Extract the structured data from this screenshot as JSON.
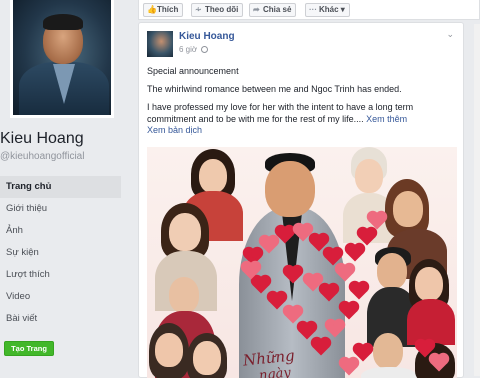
{
  "sidebar": {
    "page_name": "Kieu Hoang",
    "handle": "@kieuhoangofficial",
    "items": [
      {
        "label": "Trang chủ"
      },
      {
        "label": "Giới thiệu"
      },
      {
        "label": "Ảnh"
      },
      {
        "label": "Sự kiện"
      },
      {
        "label": "Lượt thích"
      },
      {
        "label": "Video"
      },
      {
        "label": "Bài viết"
      }
    ],
    "create_page_label": "Tạo Trang"
  },
  "actionbar": {
    "like": "Thích",
    "follow": "Theo dõi",
    "share": "Chia sẻ",
    "more": "Khác"
  },
  "post": {
    "author": "Kieu Hoang",
    "time": "6 giờ",
    "line1": "Special announcement",
    "line2": "The whirlwind romance between me and Ngoc Trinh has ended.",
    "line3": "I have professed my love for her with the intent to have a long term commitment and to be with me for the rest of my life....",
    "see_more": "Xem thêm",
    "translate": "Xem bản dịch",
    "image_text_1": "Những",
    "image_text_2": "ngày"
  },
  "colors": {
    "link_blue": "#365899",
    "button_green": "#42b72a",
    "heart_red": "#d81e3b"
  },
  "icons": {
    "like": "thumbs-up-icon",
    "follow": "rss-icon",
    "share": "share-arrow-icon",
    "more": "ellipsis-icon"
  }
}
